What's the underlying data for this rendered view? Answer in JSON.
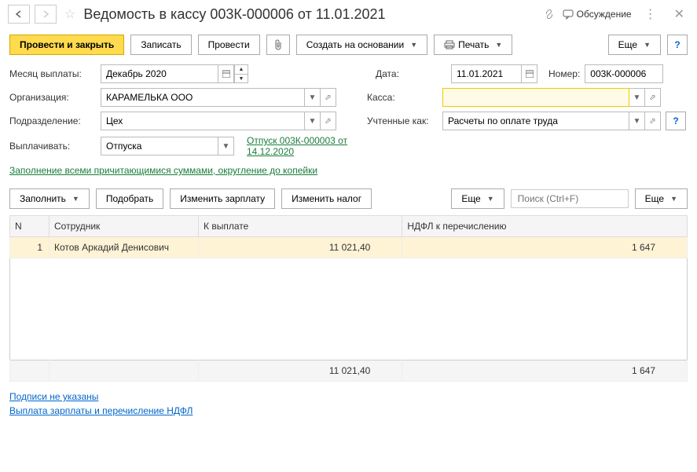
{
  "header": {
    "title": "Ведомость в кассу 003К-000006 от 11.01.2021",
    "discuss": "Обсуждение"
  },
  "toolbar": {
    "post_close": "Провести и закрыть",
    "save": "Записать",
    "post": "Провести",
    "create_from": "Создать на основании",
    "print": "Печать",
    "more": "Еще",
    "help": "?"
  },
  "form": {
    "month_label": "Месяц выплаты:",
    "month_value": "Декабрь 2020",
    "date_label": "Дата:",
    "date_value": "11.01.2021",
    "number_label": "Номер:",
    "number_value": "003К-000006",
    "org_label": "Организация:",
    "org_value": "КАРАМЕЛЬКА ООО",
    "kassa_label": "Касса:",
    "kassa_value": "",
    "dept_label": "Подразделение:",
    "dept_value": "Цех",
    "accounted_label": "Учтенные как:",
    "accounted_value": "Расчеты по оплате труда",
    "pay_label": "Выплачивать:",
    "pay_value": "Отпуска",
    "doc_link": "Отпуск 003К-000003 от 14.12.2020",
    "fill_link": "Заполнение всеми причитающимися суммами, округление до копейки"
  },
  "toolbar2": {
    "fill": "Заполнить",
    "pick": "Подобрать",
    "change_salary": "Изменить зарплату",
    "change_tax": "Изменить налог",
    "more": "Еще",
    "search_ph": "Поиск (Ctrl+F)",
    "more2": "Еще"
  },
  "table": {
    "col_n": "N",
    "col_emp": "Сотрудник",
    "col_pay": "К выплате",
    "col_tax": "НДФЛ к перечислению",
    "rows": [
      {
        "n": "1",
        "emp": "Котов Аркадий Денисович",
        "pay": "11 021,40",
        "tax": "1 647"
      }
    ],
    "total_pay": "11 021,40",
    "total_tax": "1 647"
  },
  "footer": {
    "sign": "Подписи не указаны",
    "pay_ndfl": "Выплата зарплаты и перечисление НДФЛ"
  }
}
